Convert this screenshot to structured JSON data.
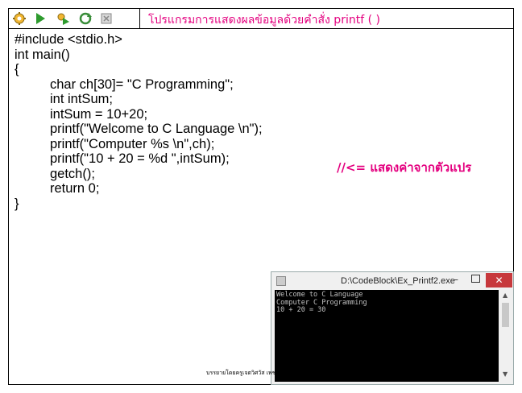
{
  "toolbar": {
    "title": "โปรแกรมการแสดงผลข้อมูลด้วยคำสั่ง printf ( )",
    "icons": [
      "gear-icon",
      "run-icon",
      "build-run-icon",
      "rebuild-icon",
      "stop-icon"
    ]
  },
  "code": {
    "lines": [
      "#include <stdio.h>",
      "int main()",
      "{",
      "char ch[30]= \"C Programming\";",
      "int intSum;",
      "intSum = 10+20;",
      "printf(\"Welcome to C Language \\n\");",
      "printf(\"Computer %s \\n\",ch);",
      "printf(\"10 + 20 = %d \",intSum);",
      "getch();",
      "return 0;",
      "}"
    ]
  },
  "comment": "//<= แสดงค่าจากตัวแปร",
  "console": {
    "title": "D:\\CodeBlock\\Ex_Printf2.exe",
    "minimize": "–",
    "close": "✕",
    "output": [
      "Welcome to C Language",
      "Computer C Programming",
      "10 + 20 = 30"
    ]
  },
  "credit": "บรรยายโดยครูเจตวิศวัส เพชรนิล",
  "colors": {
    "accent": "#e4007f",
    "close": "#c7383c"
  }
}
